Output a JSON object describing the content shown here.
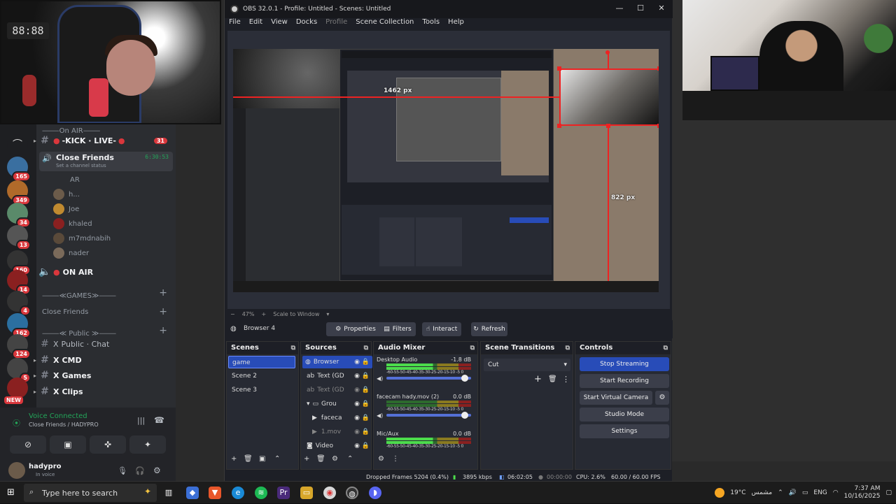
{
  "discord": {
    "on_air_header": "⸻On AIR⸻",
    "kick_live": "-KICK · LIVE-",
    "kick_badge": "31",
    "close_friends": "Close Friends",
    "close_friends_time": "6:30:53",
    "channel_status_placeholder": "Set a channel status",
    "ar_label": "AR",
    "members": [
      "h...",
      "Joe",
      "khaled",
      "m7mdnabih",
      "nader"
    ],
    "on_air_channel": "ON AIR",
    "games_category": "⸻≪GAMES≫⸻",
    "close_friends_category": "Close Friends",
    "public_category": "⸻≪ Public ≫⸻",
    "public_chat": "Public · Chat",
    "cmd": "CMD",
    "games": "Games",
    "clips": "Clips",
    "guild_badges": [
      "165",
      "349",
      "34",
      "13",
      "160",
      "14",
      "4",
      "162",
      "124",
      "5"
    ],
    "new_badge": "NEW",
    "voice_connected": "Voice Connected",
    "voice_location": "Close Friends / HADYPRO",
    "username": "hadypro",
    "user_status": "In voice",
    "clock_text": "88:88"
  },
  "obs": {
    "title": "OBS 32.0.1 - Profile: Untitled - Scenes: Untitled",
    "menu": [
      "File",
      "Edit",
      "View",
      "Docks",
      "Profile",
      "Scene Collection",
      "Tools",
      "Help"
    ],
    "width_label": "1462 px",
    "height_label": "822 px",
    "zoom_percent": "47%",
    "scale_mode": "Scale to Window",
    "selected_source": "Browser 4",
    "context_buttons": {
      "properties": "Properties",
      "filters": "Filters",
      "interact": "Interact",
      "refresh": "Refresh"
    },
    "docks": {
      "scenes": "Scenes",
      "sources": "Sources",
      "audio_mixer": "Audio Mixer",
      "scene_transitions": "Scene Transitions",
      "controls": "Controls"
    },
    "scenes": [
      "game",
      "Scene 2",
      "Scene 3"
    ],
    "sources": [
      "Browser",
      "Text (GD",
      "Text (GD",
      "Grou",
      "faceca",
      "1.mov",
      "Video"
    ],
    "mixer": [
      {
        "name": "Desktop Audio",
        "db": "-1.8 dB"
      },
      {
        "name": "facecam hady.mov (2)",
        "db": "0.0 dB"
      },
      {
        "name": "Mic/Aux",
        "db": "0.0 dB"
      }
    ],
    "meter_scale": "-60-55-50-45-40-35-30-25-20-15-10 -5 0",
    "transition": "Cut",
    "controls": [
      "Stop Streaming",
      "Start Recording",
      "Start Virtual Camera",
      "Studio Mode",
      "Settings"
    ],
    "status": {
      "dropped": "Dropped Frames 5204 (0.4%)",
      "bitrate": "3895 kbps",
      "stream_time": "06:02:05",
      "rec_time": "00:00:00",
      "cpu": "CPU: 2.6%",
      "fps": "60.00 / 60.00 FPS"
    }
  },
  "taskbar": {
    "search_placeholder": "Type here to search",
    "weather": "19°C",
    "weather_desc": "مشمس",
    "lang": "ENG",
    "time": "7:37 AM",
    "date": "10/16/2025"
  },
  "colors": {
    "obs_accent": "#284cb8",
    "discord_red": "#da373c",
    "selection_red": "#e22222",
    "voice_green": "#23a559"
  }
}
